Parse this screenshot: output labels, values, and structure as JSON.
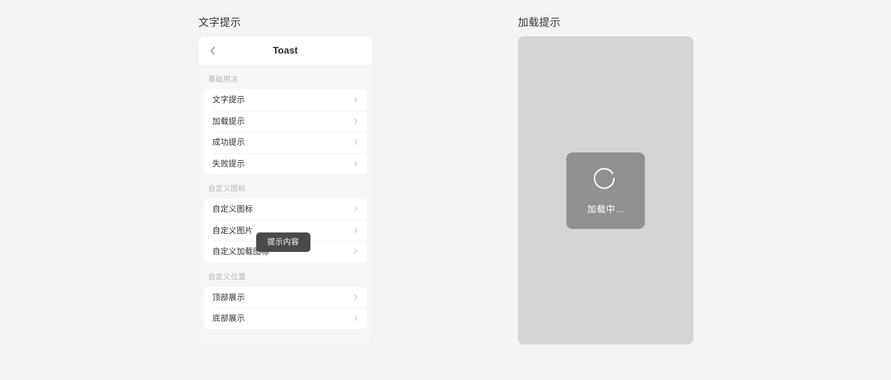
{
  "page": {
    "background_color": "#f2f4f6"
  },
  "panels": {
    "toast": {
      "title": "文字提示",
      "phone": {
        "header": {
          "back_icon": "chevron-left-icon",
          "title": "Toast"
        },
        "groups": [
          {
            "title": "基础用法",
            "items": [
              {
                "label": "文字提示",
                "arrow": "chevron-right-icon"
              },
              {
                "label": "加载提示",
                "arrow": "chevron-right-icon"
              },
              {
                "label": "成功提示",
                "arrow": "chevron-right-icon"
              },
              {
                "label": "失败提示",
                "arrow": "chevron-right-icon"
              }
            ]
          },
          {
            "title": "自定义图标",
            "items": [
              {
                "label": "自定义图标",
                "arrow": "chevron-right-icon"
              },
              {
                "label": "自定义图片",
                "arrow": "chevron-right-icon"
              },
              {
                "label": "自定义加载图标",
                "arrow": "chevron-right-icon"
              }
            ]
          },
          {
            "title": "自定义位置",
            "items": [
              {
                "label": "顶部展示",
                "arrow": "chevron-right-icon"
              },
              {
                "label": "底部展示",
                "arrow": "chevron-right-icon"
              }
            ]
          }
        ],
        "toast_bubble": {
          "text": "提示内容",
          "background_color": "#4a4a4a",
          "text_color": "#ffffff"
        }
      }
    },
    "loading": {
      "title": "加载提示",
      "mask": {
        "background_color": "#d4d4d4",
        "box": {
          "spinner_icon": "loading-spinner-icon",
          "text": "加载中...",
          "background_color": "rgba(64,64,64,0.45)",
          "text_color": "#ffffff"
        }
      }
    }
  }
}
